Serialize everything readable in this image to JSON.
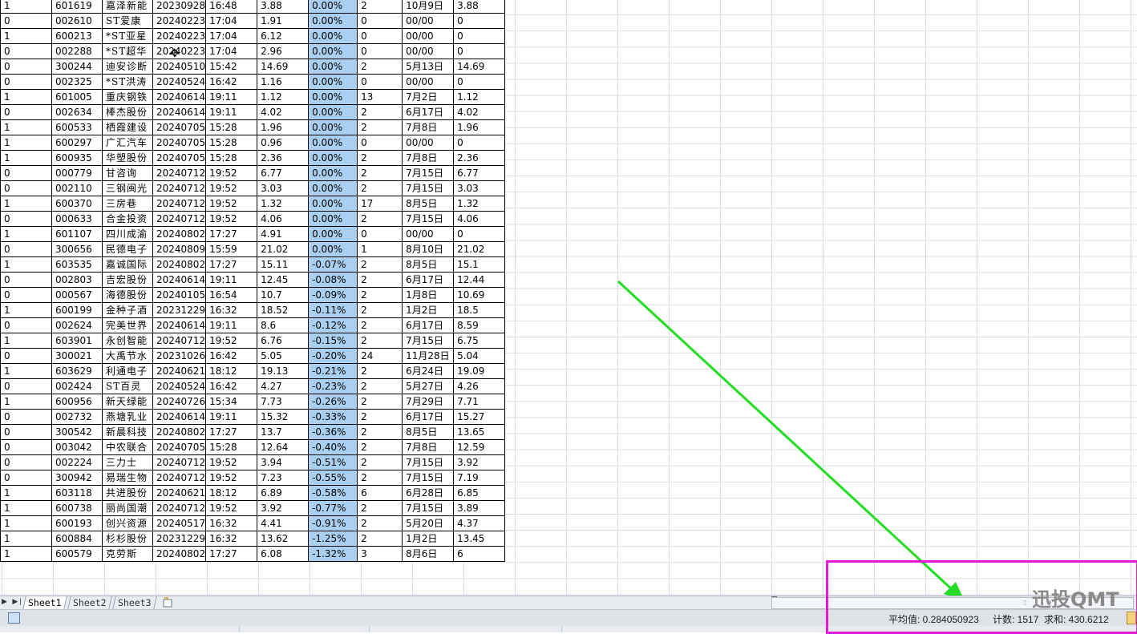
{
  "rows": [
    {
      "flag": "1",
      "code": "601619",
      "name": "嘉泽新能",
      "date": "20230928",
      "time": "16:48",
      "price": "3.88",
      "pct": "0.00%",
      "n": "2",
      "day": "10月9日",
      "val": "3.88"
    },
    {
      "flag": "0",
      "code": "002610",
      "name": "ST爱康",
      "date": "20240223",
      "time": "17:04",
      "price": "1.91",
      "pct": "0.00%",
      "n": "0",
      "day": "00/00",
      "val": "0"
    },
    {
      "flag": "1",
      "code": "600213",
      "name": "*ST亚星",
      "date": "20240223",
      "time": "17:04",
      "price": "6.12",
      "pct": "0.00%",
      "n": "0",
      "day": "00/00",
      "val": "0"
    },
    {
      "flag": "0",
      "code": "002288",
      "name": "*ST超华",
      "date": "20240223",
      "time": "17:04",
      "price": "2.96",
      "pct": "0.00%",
      "n": "0",
      "day": "00/00",
      "val": "0"
    },
    {
      "flag": "0",
      "code": "300244",
      "name": "迪安诊断",
      "date": "20240510",
      "time": "15:42",
      "price": "14.69",
      "pct": "0.00%",
      "n": "2",
      "day": "5月13日",
      "val": "14.69"
    },
    {
      "flag": "0",
      "code": "002325",
      "name": "*ST洪涛",
      "date": "20240524",
      "time": "16:42",
      "price": "1.16",
      "pct": "0.00%",
      "n": "0",
      "day": "00/00",
      "val": "0"
    },
    {
      "flag": "1",
      "code": "601005",
      "name": "重庆钢铁",
      "date": "20240614",
      "time": "19:11",
      "price": "1.12",
      "pct": "0.00%",
      "n": "13",
      "day": "7月2日",
      "val": "1.12"
    },
    {
      "flag": "0",
      "code": "002634",
      "name": "棒杰股份",
      "date": "20240614",
      "time": "19:11",
      "price": "4.02",
      "pct": "0.00%",
      "n": "2",
      "day": "6月17日",
      "val": "4.02"
    },
    {
      "flag": "1",
      "code": "600533",
      "name": "栖霞建设",
      "date": "20240705",
      "time": "15:28",
      "price": "1.96",
      "pct": "0.00%",
      "n": "2",
      "day": "7月8日",
      "val": "1.96"
    },
    {
      "flag": "1",
      "code": "600297",
      "name": "广汇汽车",
      "date": "20240705",
      "time": "15:28",
      "price": "0.96",
      "pct": "0.00%",
      "n": "0",
      "day": "00/00",
      "val": "0"
    },
    {
      "flag": "1",
      "code": "600935",
      "name": "华塑股份",
      "date": "20240705",
      "time": "15:28",
      "price": "2.36",
      "pct": "0.00%",
      "n": "2",
      "day": "7月8日",
      "val": "2.36"
    },
    {
      "flag": "0",
      "code": "000779",
      "name": "甘咨询",
      "date": "20240712",
      "time": "19:52",
      "price": "6.77",
      "pct": "0.00%",
      "n": "2",
      "day": "7月15日",
      "val": "6.77"
    },
    {
      "flag": "0",
      "code": "002110",
      "name": "三钢闽光",
      "date": "20240712",
      "time": "19:52",
      "price": "3.03",
      "pct": "0.00%",
      "n": "2",
      "day": "7月15日",
      "val": "3.03"
    },
    {
      "flag": "1",
      "code": "600370",
      "name": "三房巷",
      "date": "20240712",
      "time": "19:52",
      "price": "1.32",
      "pct": "0.00%",
      "n": "17",
      "day": "8月5日",
      "val": "1.32"
    },
    {
      "flag": "0",
      "code": "000633",
      "name": "合金投资",
      "date": "20240712",
      "time": "19:52",
      "price": "4.06",
      "pct": "0.00%",
      "n": "2",
      "day": "7月15日",
      "val": "4.06"
    },
    {
      "flag": "1",
      "code": "601107",
      "name": "四川成渝",
      "date": "20240802",
      "time": "17:27",
      "price": "4.91",
      "pct": "0.00%",
      "n": "0",
      "day": "00/00",
      "val": "0"
    },
    {
      "flag": "0",
      "code": "300656",
      "name": "民德电子",
      "date": "20240809",
      "time": "15:59",
      "price": "21.02",
      "pct": "0.00%",
      "n": "1",
      "day": "8月10日",
      "val": "21.02"
    },
    {
      "flag": "1",
      "code": "603535",
      "name": "嘉诚国际",
      "date": "20240802",
      "time": "17:27",
      "price": "15.11",
      "pct": "-0.07%",
      "n": "2",
      "day": "8月5日",
      "val": "15.1"
    },
    {
      "flag": "0",
      "code": "002803",
      "name": "吉宏股份",
      "date": "20240614",
      "time": "19:11",
      "price": "12.45",
      "pct": "-0.08%",
      "n": "2",
      "day": "6月17日",
      "val": "12.44"
    },
    {
      "flag": "0",
      "code": "000567",
      "name": "海德股份",
      "date": "20240105",
      "time": "16:54",
      "price": "10.7",
      "pct": "-0.09%",
      "n": "2",
      "day": "1月8日",
      "val": "10.69"
    },
    {
      "flag": "1",
      "code": "600199",
      "name": "金种子酒",
      "date": "20231229",
      "time": "16:32",
      "price": "18.52",
      "pct": "-0.11%",
      "n": "2",
      "day": "1月2日",
      "val": "18.5"
    },
    {
      "flag": "0",
      "code": "002624",
      "name": "完美世界",
      "date": "20240614",
      "time": "19:11",
      "price": "8.6",
      "pct": "-0.12%",
      "n": "2",
      "day": "6月17日",
      "val": "8.59"
    },
    {
      "flag": "1",
      "code": "603901",
      "name": "永创智能",
      "date": "20240712",
      "time": "19:52",
      "price": "6.76",
      "pct": "-0.15%",
      "n": "2",
      "day": "7月15日",
      "val": "6.75"
    },
    {
      "flag": "0",
      "code": "300021",
      "name": "大禹节水",
      "date": "20231026",
      "time": "16:42",
      "price": "5.05",
      "pct": "-0.20%",
      "n": "24",
      "day": "11月28日",
      "val": "5.04"
    },
    {
      "flag": "1",
      "code": "603629",
      "name": "利通电子",
      "date": "20240621",
      "time": "18:12",
      "price": "19.13",
      "pct": "-0.21%",
      "n": "2",
      "day": "6月24日",
      "val": "19.09"
    },
    {
      "flag": "0",
      "code": "002424",
      "name": "ST百灵",
      "date": "20240524",
      "time": "16:42",
      "price": "4.27",
      "pct": "-0.23%",
      "n": "2",
      "day": "5月27日",
      "val": "4.26"
    },
    {
      "flag": "1",
      "code": "600956",
      "name": "新天绿能",
      "date": "20240726",
      "time": "15:34",
      "price": "7.73",
      "pct": "-0.26%",
      "n": "2",
      "day": "7月29日",
      "val": "7.71"
    },
    {
      "flag": "0",
      "code": "002732",
      "name": "燕塘乳业",
      "date": "20240614",
      "time": "19:11",
      "price": "15.32",
      "pct": "-0.33%",
      "n": "2",
      "day": "6月17日",
      "val": "15.27"
    },
    {
      "flag": "0",
      "code": "300542",
      "name": "新晨科技",
      "date": "20240802",
      "time": "17:27",
      "price": "13.7",
      "pct": "-0.36%",
      "n": "2",
      "day": "8月5日",
      "val": "13.65"
    },
    {
      "flag": "0",
      "code": "003042",
      "name": "中农联合",
      "date": "20240705",
      "time": "15:28",
      "price": "12.64",
      "pct": "-0.40%",
      "n": "2",
      "day": "7月8日",
      "val": "12.59"
    },
    {
      "flag": "0",
      "code": "002224",
      "name": "三力士",
      "date": "20240712",
      "time": "19:52",
      "price": "3.94",
      "pct": "-0.51%",
      "n": "2",
      "day": "7月15日",
      "val": "3.92"
    },
    {
      "flag": "0",
      "code": "300942",
      "name": "易瑞生物",
      "date": "20240712",
      "time": "19:52",
      "price": "7.23",
      "pct": "-0.55%",
      "n": "2",
      "day": "7月15日",
      "val": "7.19"
    },
    {
      "flag": "1",
      "code": "603118",
      "name": "共进股份",
      "date": "20240621",
      "time": "18:12",
      "price": "6.89",
      "pct": "-0.58%",
      "n": "6",
      "day": "6月28日",
      "val": "6.85"
    },
    {
      "flag": "1",
      "code": "600738",
      "name": "丽尚国潮",
      "date": "20240712",
      "time": "19:52",
      "price": "3.92",
      "pct": "-0.77%",
      "n": "2",
      "day": "7月15日",
      "val": "3.89"
    },
    {
      "flag": "1",
      "code": "600193",
      "name": "创兴资源",
      "date": "20240517",
      "time": "16:32",
      "price": "4.41",
      "pct": "-0.91%",
      "n": "2",
      "day": "5月20日",
      "val": "4.37"
    },
    {
      "flag": "1",
      "code": "600884",
      "name": "杉杉股份",
      "date": "20231229",
      "time": "16:32",
      "price": "13.62",
      "pct": "-1.25%",
      "n": "2",
      "day": "1月2日",
      "val": "13.45"
    },
    {
      "flag": "1",
      "code": "600579",
      "name": "克劳斯",
      "date": "20240802",
      "time": "17:27",
      "price": "6.08",
      "pct": "-1.32%",
      "n": "3",
      "day": "8月6日",
      "val": "6"
    }
  ],
  "sheet_tabs": [
    "Sheet1",
    "Sheet2",
    "Sheet3"
  ],
  "status": {
    "average": "平均值: 0.284050923",
    "count": "计数: 1517",
    "sum": "求和: 430.6212"
  },
  "watermark": "迅投QMT",
  "colors": {
    "selected_column": "#a9d0f0",
    "arrow": "#22dd22",
    "highlight_box": "#e41ad8"
  },
  "icons": {
    "tab_nav": "tab-nav-arrows-icon",
    "new_sheet": "new-sheet-icon",
    "macro": "macro-record-icon",
    "cursor": "cell-cross-cursor-icon"
  }
}
